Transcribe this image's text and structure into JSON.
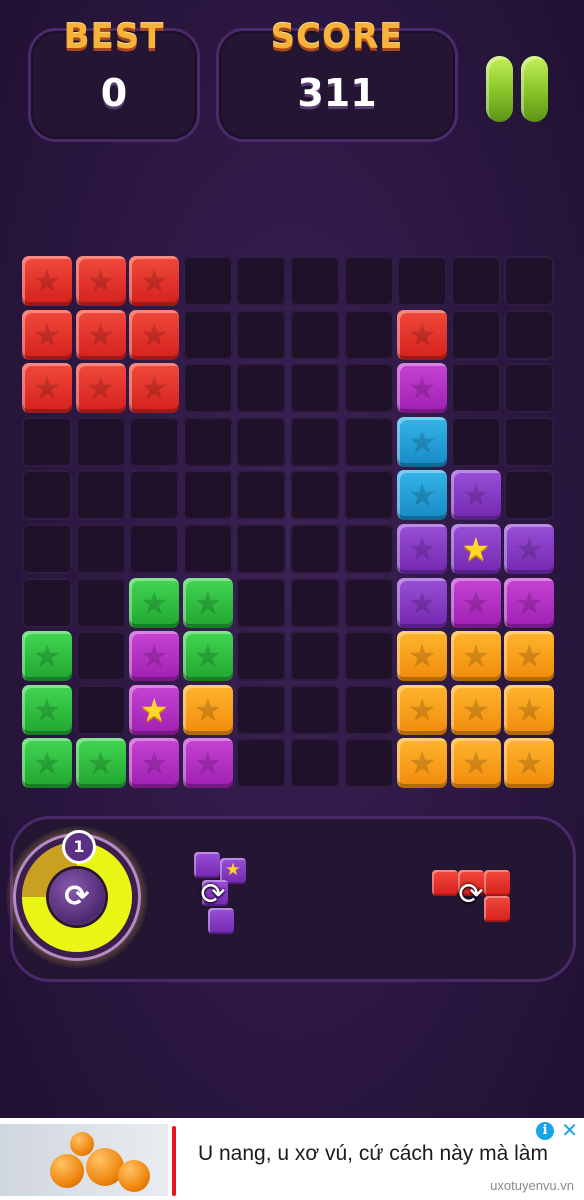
{
  "scoreboard": {
    "best_label": "BEST",
    "best_value": "0",
    "score_label": "SCORE",
    "score_value": "311"
  },
  "board": {
    "columns": 10,
    "rows": 10,
    "blocks": [
      {
        "r": 0,
        "c": 0,
        "color": "red"
      },
      {
        "r": 0,
        "c": 1,
        "color": "red"
      },
      {
        "r": 0,
        "c": 2,
        "color": "red"
      },
      {
        "r": 1,
        "c": 0,
        "color": "red"
      },
      {
        "r": 1,
        "c": 1,
        "color": "red"
      },
      {
        "r": 1,
        "c": 2,
        "color": "red"
      },
      {
        "r": 1,
        "c": 7,
        "color": "red"
      },
      {
        "r": 2,
        "c": 0,
        "color": "red"
      },
      {
        "r": 2,
        "c": 1,
        "color": "red"
      },
      {
        "r": 2,
        "c": 2,
        "color": "red"
      },
      {
        "r": 2,
        "c": 7,
        "color": "magenta"
      },
      {
        "r": 3,
        "c": 7,
        "color": "cyan"
      },
      {
        "r": 4,
        "c": 7,
        "color": "cyan"
      },
      {
        "r": 4,
        "c": 8,
        "color": "purple"
      },
      {
        "r": 5,
        "c": 7,
        "color": "purple"
      },
      {
        "r": 5,
        "c": 8,
        "color": "purple",
        "star": "gold"
      },
      {
        "r": 5,
        "c": 9,
        "color": "purple"
      },
      {
        "r": 6,
        "c": 2,
        "color": "green"
      },
      {
        "r": 6,
        "c": 3,
        "color": "green"
      },
      {
        "r": 6,
        "c": 7,
        "color": "purple"
      },
      {
        "r": 6,
        "c": 8,
        "color": "magenta"
      },
      {
        "r": 6,
        "c": 9,
        "color": "magenta"
      },
      {
        "r": 7,
        "c": 0,
        "color": "green"
      },
      {
        "r": 7,
        "c": 2,
        "color": "magenta"
      },
      {
        "r": 7,
        "c": 3,
        "color": "green"
      },
      {
        "r": 7,
        "c": 7,
        "color": "orange"
      },
      {
        "r": 7,
        "c": 8,
        "color": "orange"
      },
      {
        "r": 7,
        "c": 9,
        "color": "orange"
      },
      {
        "r": 8,
        "c": 0,
        "color": "green"
      },
      {
        "r": 8,
        "c": 2,
        "color": "magenta",
        "star": "gold"
      },
      {
        "r": 8,
        "c": 3,
        "color": "orange"
      },
      {
        "r": 8,
        "c": 7,
        "color": "orange"
      },
      {
        "r": 8,
        "c": 8,
        "color": "orange"
      },
      {
        "r": 8,
        "c": 9,
        "color": "orange"
      },
      {
        "r": 9,
        "c": 0,
        "color": "green"
      },
      {
        "r": 9,
        "c": 1,
        "color": "green"
      },
      {
        "r": 9,
        "c": 2,
        "color": "magenta"
      },
      {
        "r": 9,
        "c": 3,
        "color": "magenta"
      },
      {
        "r": 9,
        "c": 7,
        "color": "orange"
      },
      {
        "r": 9,
        "c": 8,
        "color": "orange"
      },
      {
        "r": 9,
        "c": 9,
        "color": "orange"
      }
    ]
  },
  "tray": {
    "bomb_count": "1",
    "bomb_fill_fraction": 0.75,
    "pieces": [
      {
        "color": "purple",
        "shape": "vertical-4-with-gold-star-side"
      },
      {
        "color": "red",
        "shape": "l-tetromino"
      }
    ]
  },
  "ad": {
    "headline": "U nang, u xơ vú, cứ cách này mà làm",
    "url": "uxotuyenvu.vn",
    "info_icon": "info-icon",
    "close_icon": "close-icon",
    "info_glyph": "i",
    "close_glyph": "✕"
  },
  "colors": {
    "red": "#e0302a",
    "green": "#2fbf3e",
    "purple": "#8a3cc8",
    "magenta": "#b22fc4",
    "cyan": "#25a2d8",
    "orange": "#f9a21c",
    "background": "#2b1741"
  }
}
